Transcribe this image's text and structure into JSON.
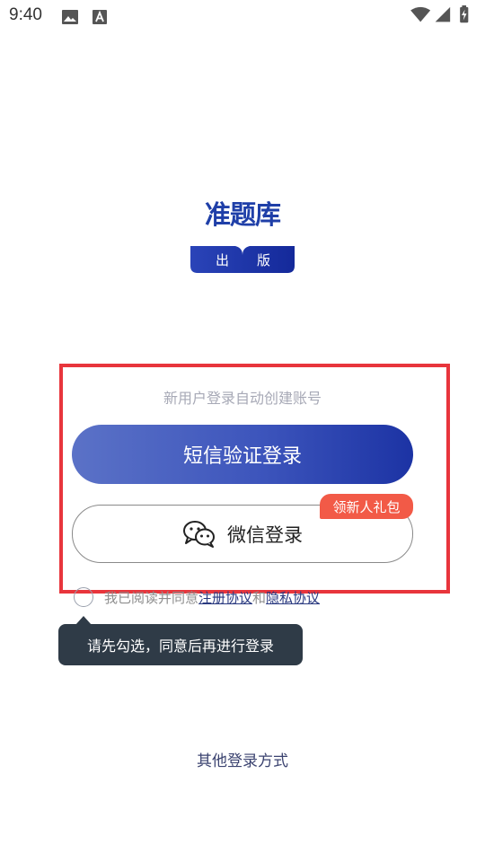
{
  "status_bar": {
    "time": "9:40",
    "icons": [
      "image-icon",
      "text-box-icon",
      "wifi-icon",
      "signal-icon",
      "battery-charging-icon"
    ]
  },
  "brand": {
    "logo_text": "准题库",
    "badge_left": "出",
    "badge_right": "版",
    "colors": {
      "brand_blue": "#1f3fa8"
    }
  },
  "login": {
    "hint": "新用户登录自动创建账号",
    "sms_button": "短信验证登录",
    "wechat_button": "微信登录",
    "gift_badge": "领新人礼包",
    "colors": {
      "highlight": "#e8353c",
      "gift": "#f25a47"
    }
  },
  "agreement": {
    "prefix": "我已阅读并同意",
    "register_link": "注册协议",
    "and": "和",
    "privacy_link": "隐私协议"
  },
  "tooltip": {
    "text": "请先勾选，同意后再进行登录"
  },
  "footer": {
    "other_login": "其他登录方式"
  }
}
